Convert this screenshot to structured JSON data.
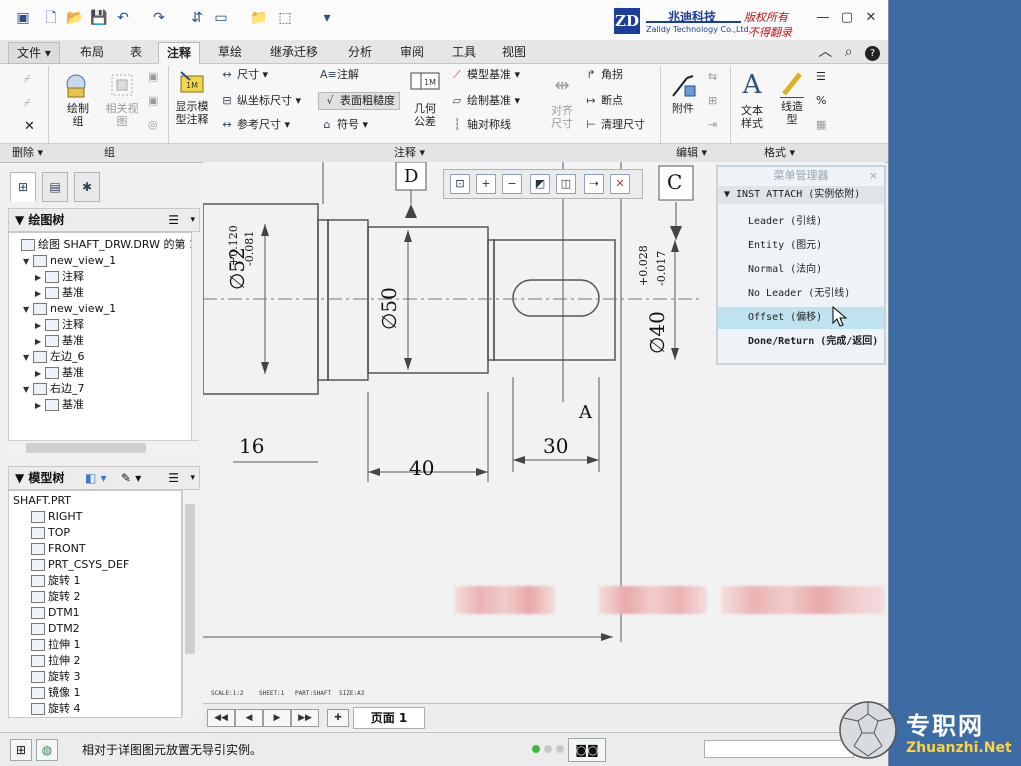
{
  "quick_access": {
    "icons": [
      "window-icon",
      "new-icon",
      "open-icon",
      "save-icon",
      "undo-icon",
      "redo-icon",
      "regenerate-icon",
      "windows-icon",
      "folder-icon",
      "select-icon"
    ]
  },
  "brand": {
    "logo": "ZD",
    "name_cn": "兆迪科技",
    "name_en": "Zalldy Technology Co.,Ltd.",
    "note1": "版权所有",
    "note2": "不得翻录"
  },
  "tabs": [
    "文件",
    "布局",
    "表",
    "注释",
    "草绘",
    "继承迁移",
    "分析",
    "审阅",
    "工具",
    "视图"
  ],
  "ribbon": {
    "delete": "删除",
    "group": "组",
    "draw_group": "绘制\n组",
    "related_view": "相关视\n图",
    "show_model_annotation": "显示模\n型注释",
    "dimension": "尺寸",
    "ordinate_dimension": "纵坐标尺寸",
    "reference_dimension": "参考尺寸",
    "note": "注解",
    "surface_finish": "表面粗糙度",
    "symbol": "符号",
    "geometric_tolerance": "几何\n公差",
    "model_datum": "模型基准",
    "draw_datum": "绘制基准",
    "axis_symmetry": "轴对称线",
    "align_dimension": "对齐\n尺寸",
    "corner": "角拐",
    "breakpoint": "断点",
    "cleanup_dimension": "清理尺寸",
    "attach": "附件",
    "text_style": "文本\n样式",
    "line_style": "线造\n型",
    "annotate": "注释",
    "edit": "编辑",
    "format": "格式"
  },
  "left_panel": {
    "drawing_tree_title": "绘图树",
    "drawing_tree": [
      {
        "label": "绘图 SHAFT_DRW.DRW 的第 1 页",
        "indent": 0
      },
      {
        "label": "new_view_1",
        "indent": 1
      },
      {
        "label": "注释",
        "indent": 2
      },
      {
        "label": "基准",
        "indent": 2
      },
      {
        "label": "new_view_1",
        "indent": 1
      },
      {
        "label": "注释",
        "indent": 2
      },
      {
        "label": "基准",
        "indent": 2
      },
      {
        "label": "左边_6",
        "indent": 1
      },
      {
        "label": "基准",
        "indent": 2
      },
      {
        "label": "右边_7",
        "indent": 1
      },
      {
        "label": "基准",
        "indent": 2
      }
    ],
    "model_tree_title": "模型树",
    "model_tree": [
      "SHAFT.PRT",
      "RIGHT",
      "TOP",
      "FRONT",
      "PRT_CSYS_DEF",
      "旋转 1",
      "旋转 2",
      "DTM1",
      "DTM2",
      "拉伸 1",
      "拉伸 2",
      "旋转 3",
      "镜像 1",
      "旋转 4"
    ]
  },
  "drawing": {
    "datum_D": "D",
    "datum_C": "C",
    "datum_A": "A",
    "dim_52": "∅52",
    "tol_52_up": "+0.120",
    "tol_52_low": "-0.081",
    "dim_50": "∅50",
    "dim_40": "∅40",
    "tol_40_up": "+0.028",
    "tol_40_low": "-0.017",
    "len_16": "16",
    "len_40": "40",
    "len_30": "30",
    "info_scale": "SCALE:1:2",
    "info_sheet": "SHEET:1",
    "info_part": "PART:SHAFT",
    "info_size": "SIZE:A3"
  },
  "menu_manager": {
    "title": "菜单管理器",
    "close": "×",
    "section": "INST ATTACH (实例依附)",
    "items": [
      "Leader (引线)",
      "Entity (图元)",
      "Normal (法向)",
      "No Leader (无引线)",
      "Offset (偏移)",
      "Done/Return (完成/返回)"
    ],
    "selected_index": 4
  },
  "page_nav": {
    "page_label": "页面 1"
  },
  "status": {
    "message": "相对于详图图元放置无导引实例。",
    "selection_filter": ""
  },
  "watermark": {
    "cn": "专职网",
    "en": "Zhuanzhi.Net"
  },
  "colors": {
    "accent": "#1b3f98",
    "selected": "#bfe3ee",
    "brand_red": "#c01010",
    "desktop": "#3d6ba3"
  }
}
